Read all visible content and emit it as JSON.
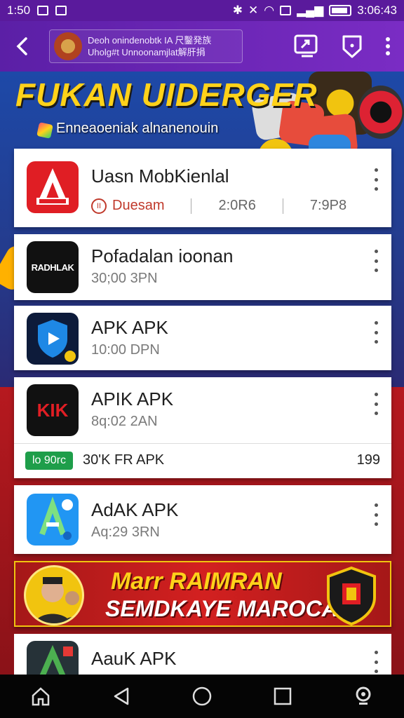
{
  "status_bar": {
    "time_left": "1:50",
    "time_right": "3:06:43"
  },
  "app_bar": {
    "title_line1": "Deoh onindenobtk IA 尺鑿発族",
    "title_line2": "Uholg#t Unnoonamjlat解肝捐"
  },
  "hero": {
    "title": "FUKAN UIDERGER",
    "subtitle": "Enneaoeniak alnanenouin"
  },
  "apps": [
    {
      "name": "Uasn MobKienlal",
      "status": "Duesam",
      "size": "2:0R6",
      "time": "7:9P8",
      "icon": "red-a-app-icon"
    },
    {
      "name": "Pofadalan ioonan",
      "time": "30;00 3PN",
      "icon_text": "RADHLAK",
      "icon": "black-radio-app-icon"
    },
    {
      "name": "APK APK",
      "time": "10:00 DPN",
      "icon": "blue-shield-play-icon"
    },
    {
      "name": "APIK APK",
      "time": "8q:02 2AN",
      "icon_text": "KIK",
      "icon": "black-red-k-app-icon"
    },
    {
      "name": "AdAK APK",
      "time": "Aq:29 3RN",
      "icon": "blue-a-app-icon"
    },
    {
      "name": "AauK APK",
      "icon": "dark-a-app-icon"
    }
  ],
  "download_row": {
    "badge": "lo 90rc",
    "text": "30'K FR APK",
    "count": "199"
  },
  "promo": {
    "line1_prefix": "Marr ",
    "line1_highlight": "RAIMRAN",
    "line2": "SEMDKAYE MAROCA"
  },
  "colors": {
    "app_bar": "#6a24b4",
    "download_badge": "#1e9e4a",
    "status_red": "#c0392b",
    "promo_red": "#c81c1c",
    "promo_gold": "#ffd21a"
  }
}
